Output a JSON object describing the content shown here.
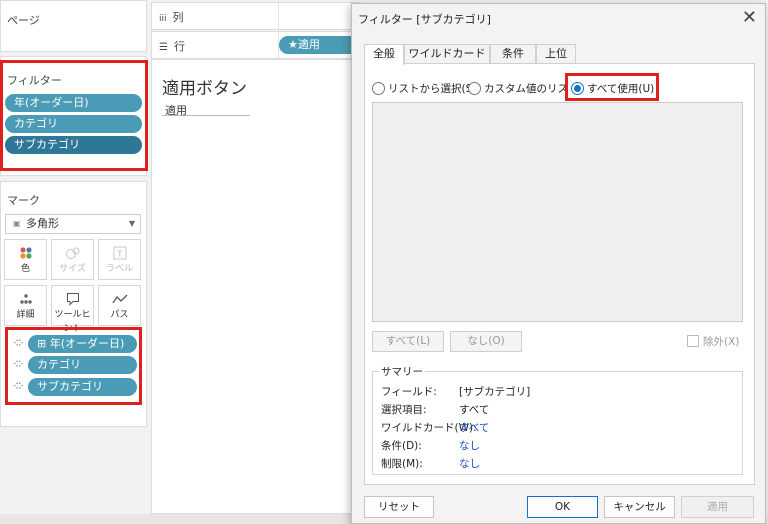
{
  "left": {
    "pages_title": "ページ",
    "filters_title": "フィルター",
    "filters": [
      "年(オーダー日)",
      "カテゴリ",
      "サブカテゴリ"
    ],
    "marks_title": "マーク",
    "mark_type": "多角形",
    "mark_buttons": [
      {
        "label": "色",
        "icon": "color-dots-icon",
        "enabled": true
      },
      {
        "label": "サイズ",
        "icon": "size-icon",
        "enabled": false
      },
      {
        "label": "ラベル",
        "icon": "label-icon",
        "enabled": false
      },
      {
        "label": "詳細",
        "icon": "detail-icon",
        "enabled": true
      },
      {
        "label": "ツールヒント",
        "icon": "tooltip-icon",
        "enabled": true
      },
      {
        "label": "パス",
        "icon": "path-icon",
        "enabled": true
      }
    ],
    "mark_pills": [
      "年(オーダー日)",
      "カテゴリ",
      "サブカテゴリ"
    ],
    "mark_pill_first_glyph": "⊞"
  },
  "shelves": {
    "columns_label": "列",
    "columns_glyph": "iii",
    "rows_label": "行",
    "rows_glyph": "☰",
    "rows_pill": "★適用"
  },
  "canvas": {
    "title": "適用ボタン",
    "param_label": "適用"
  },
  "dialog": {
    "title": "フィルター [サブカテゴリ]",
    "tabs": [
      "全般",
      "ワイルドカード",
      "条件",
      "上位"
    ],
    "radios": [
      "リストから選択(S)",
      "カスタム値のリスト(C)",
      "すべて使用(U)"
    ],
    "selected_radio": "すべて使用(U)",
    "all_button": "すべて(L)",
    "none_button": "なし(O)",
    "exclude_label": "除外(X)",
    "summary_title": "サマリー",
    "summary": [
      {
        "key": "フィールド:",
        "value": "[サブカテゴリ]",
        "link": false
      },
      {
        "key": "選択項目:",
        "value": "すべて",
        "link": false
      },
      {
        "key": "ワイルドカード(W):",
        "value": "すべて",
        "link": true
      },
      {
        "key": "条件(D):",
        "value": "なし",
        "link": true
      },
      {
        "key": "制限(M):",
        "value": "なし",
        "link": true
      }
    ],
    "reset_button": "リセット",
    "ok_button": "OK",
    "cancel_button": "キャンセル",
    "apply_button": "適用"
  },
  "colors": {
    "pill": "#4a9bb5",
    "pill_selected": "#2f7796",
    "highlight": "#e0201c",
    "accent": "#1a6fc4"
  }
}
